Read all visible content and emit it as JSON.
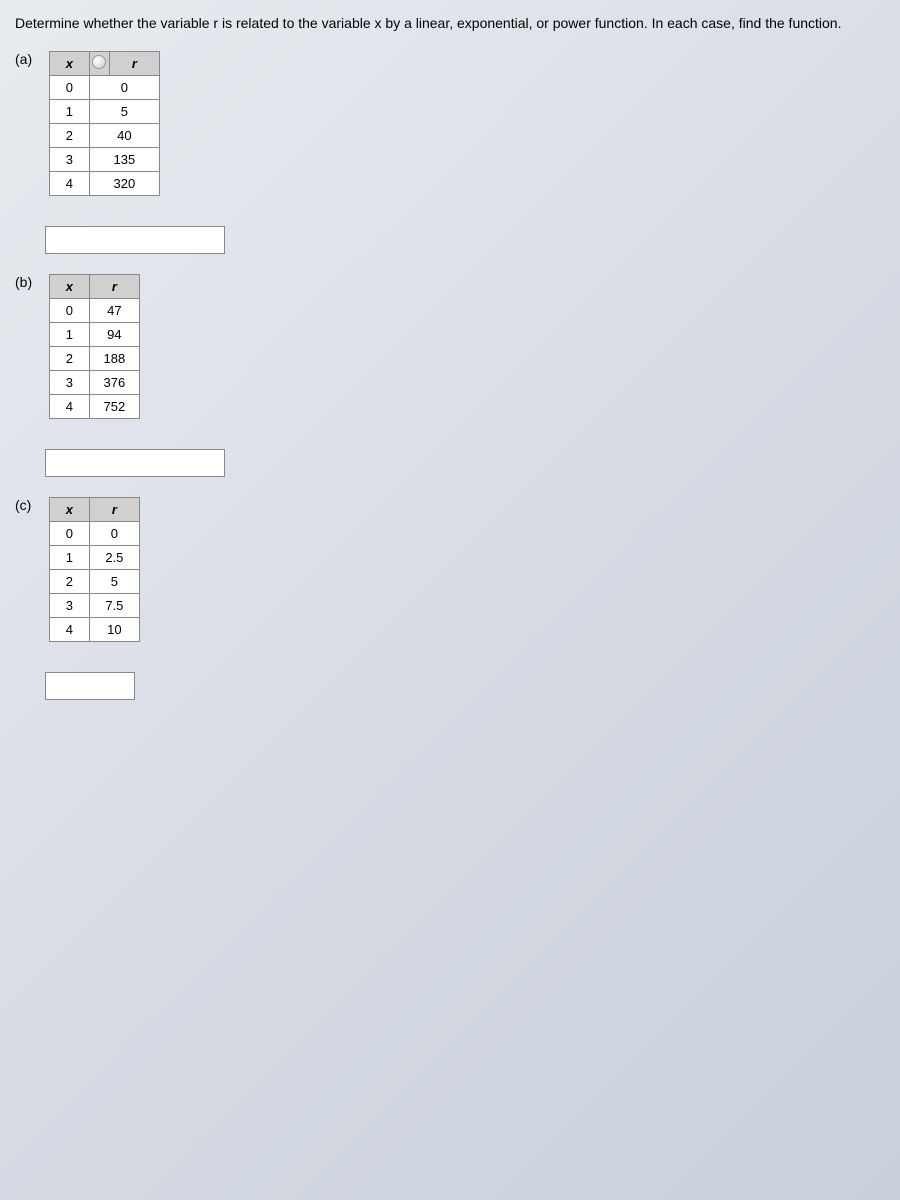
{
  "question": "Determine whether the variable r is related to the variable x by a linear, exponential, or power function. In each case, find the function.",
  "sections": {
    "a": {
      "label": "(a)",
      "headers": {
        "x": "x",
        "r": "r"
      },
      "rows": [
        {
          "x": "0",
          "r": "0"
        },
        {
          "x": "1",
          "r": "5"
        },
        {
          "x": "2",
          "r": "40"
        },
        {
          "x": "3",
          "r": "135"
        },
        {
          "x": "4",
          "r": "320"
        }
      ]
    },
    "b": {
      "label": "(b)",
      "headers": {
        "x": "x",
        "r": "r"
      },
      "rows": [
        {
          "x": "0",
          "r": "47"
        },
        {
          "x": "1",
          "r": "94"
        },
        {
          "x": "2",
          "r": "188"
        },
        {
          "x": "3",
          "r": "376"
        },
        {
          "x": "4",
          "r": "752"
        }
      ]
    },
    "c": {
      "label": "(c)",
      "headers": {
        "x": "x",
        "r": "r"
      },
      "rows": [
        {
          "x": "0",
          "r": "0"
        },
        {
          "x": "1",
          "r": "2.5"
        },
        {
          "x": "2",
          "r": "5"
        },
        {
          "x": "3",
          "r": "7.5"
        },
        {
          "x": "4",
          "r": "10"
        }
      ]
    }
  },
  "chart_data": [
    {
      "type": "table",
      "title": "(a)",
      "columns": [
        "x",
        "r"
      ],
      "rows": [
        [
          0,
          0
        ],
        [
          1,
          5
        ],
        [
          2,
          40
        ],
        [
          3,
          135
        ],
        [
          4,
          320
        ]
      ]
    },
    {
      "type": "table",
      "title": "(b)",
      "columns": [
        "x",
        "r"
      ],
      "rows": [
        [
          0,
          47
        ],
        [
          1,
          94
        ],
        [
          2,
          188
        ],
        [
          3,
          376
        ],
        [
          4,
          752
        ]
      ]
    },
    {
      "type": "table",
      "title": "(c)",
      "columns": [
        "x",
        "r"
      ],
      "rows": [
        [
          0,
          0
        ],
        [
          1,
          2.5
        ],
        [
          2,
          5
        ],
        [
          3,
          7.5
        ],
        [
          4,
          10
        ]
      ]
    }
  ]
}
